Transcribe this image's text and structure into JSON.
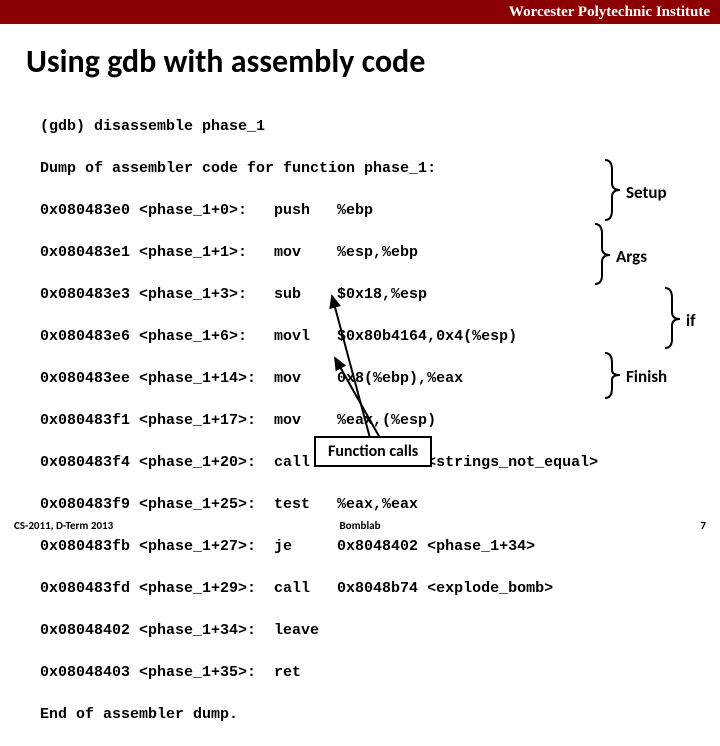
{
  "header": {
    "institution": "Worcester Polytechnic Institute"
  },
  "title": "Using gdb with assembly code",
  "code": {
    "line0": "(gdb) disassemble phase_1",
    "line1": "Dump of assembler code for function phase_1:",
    "l2": "0x080483e0 <phase_1+0>:   push   %ebp",
    "l3": "0x080483e1 <phase_1+1>:   mov    %esp,%ebp",
    "l4": "0x080483e3 <phase_1+3>:   sub    $0x18,%esp",
    "l5": "0x080483e6 <phase_1+6>:   movl   $0x80b4164,0x4(%esp)",
    "l6": "0x080483ee <phase_1+14>:  mov    0x8(%ebp),%eax",
    "l7": "0x080483f1 <phase_1+17>:  mov    %eax,(%esp)",
    "l8": "0x080483f4 <phase_1+20>:  call   0x80488db <strings_not_equal>",
    "l9": "0x080483f9 <phase_1+25>:  test   %eax,%eax",
    "l10": "0x080483fb <phase_1+27>:  je     0x8048402 <phase_1+34>",
    "l11": "0x080483fd <phase_1+29>:  call   0x8048b74 <explode_bomb>",
    "l12": "0x08048402 <phase_1+34>:  leave",
    "l13": "0x08048403 <phase_1+35>:  ret",
    "line14": "End of assembler dump."
  },
  "annotations": {
    "setup": "Setup",
    "args": "Args",
    "if": "if",
    "finish": "Finish",
    "fncalls": "Function calls"
  },
  "footer": {
    "left": "CS-2011, D-Term 2013",
    "center": "Bomblab",
    "right": "7"
  }
}
